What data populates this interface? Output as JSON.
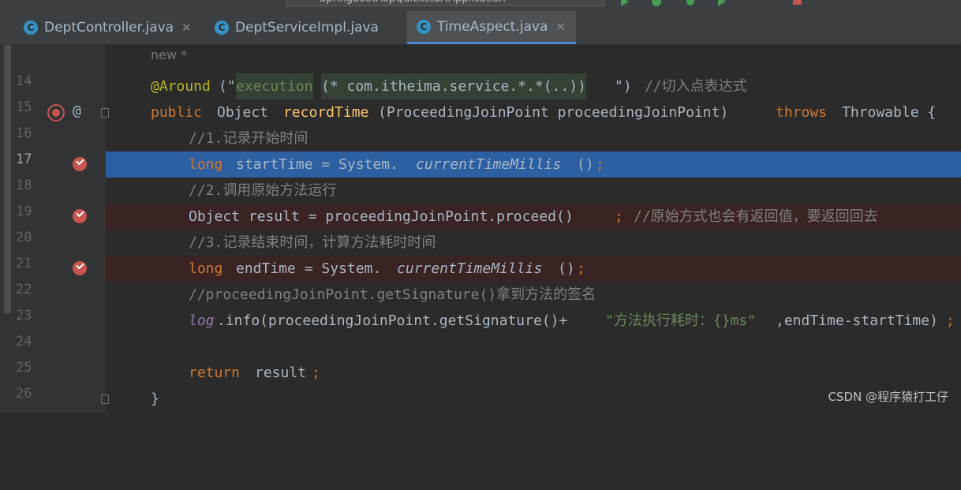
{
  "toolbar": {
    "run_config": "SpringbootAopQuickstartApplication"
  },
  "tabs": [
    {
      "label": "DeptController.java",
      "active": false
    },
    {
      "label": "DeptServiceImpl.java",
      "active": false
    },
    {
      "label": "TimeAspect.java",
      "active": true
    }
  ],
  "editor": {
    "hint": "new *",
    "line_numbers": [
      "14",
      "15",
      "16",
      "17",
      "18",
      "19",
      "20",
      "21",
      "22",
      "23",
      "24",
      "25",
      "26"
    ],
    "at_symbol": "@",
    "code": {
      "l14_ann": "@Around",
      "l14_p1": "(\"",
      "l14_exec": "execution",
      "l14_expr": "(* com.itheima.service.*.*(..))",
      "l14_p2": "\")",
      "l14_cm": "//切入点表达式",
      "l15_kw": "public",
      "l15_type": "Object",
      "l15_fn": "recordTime",
      "l15_params": "(ProceedingJoinPoint proceedingJoinPoint)",
      "l15_throws": "throws",
      "l15_rest": "Throwable {",
      "l16_cm": "//1.记录开始时间",
      "l17_kw": "long",
      "l17_a": "startTime = System.",
      "l17_it": "currentTimeMillis",
      "l17_b": "()",
      "l17_semi": ";",
      "l18_cm": "//2.调用原始方法运行",
      "l19_a": "Object result = proceedingJoinPoint.proceed()",
      "l19_semi": ";",
      "l19_cm": "//原始方式也会有返回值，要返回回去",
      "l20_cm": "//3.记录结束时间，计算方法耗时时间",
      "l21_kw": "long",
      "l21_a": "endTime = System.",
      "l21_it": "currentTimeMillis",
      "l21_b": "()",
      "l21_semi": ";",
      "l22_cm": "//proceedingJoinPoint.getSignature()拿到方法的签名",
      "l23_log": "log",
      "l23_a": ".info(proceedingJoinPoint.getSignature()+",
      "l23_str": "\"方法执行耗时：{}ms\"",
      "l23_b": ",endTime-startTime)",
      "l23_semi": ";",
      "l25_kw": "return",
      "l25_a": "result",
      "l25_semi": ";",
      "l26_a": "}"
    }
  },
  "watermark": "CSDN @程序猿打工仔",
  "colors": {
    "keyword": "#cc7832",
    "annotation": "#bbb529",
    "string": "#6a8759",
    "comment": "#808080",
    "selection": "#2d5fa3",
    "breakpoint": "#c75450"
  }
}
